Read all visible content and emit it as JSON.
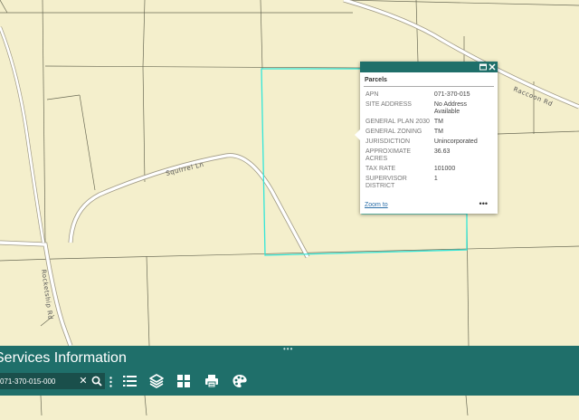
{
  "map": {
    "road_labels": [
      "Squirrel Ln",
      "Raccoon Rd",
      "Rocketship Rd"
    ]
  },
  "popup": {
    "title": "Parcels",
    "rows": [
      {
        "key": "APN",
        "value": "071-370-015"
      },
      {
        "key": "SITE ADDRESS",
        "value": "No Address Available"
      },
      {
        "key": "GENERAL PLAN 2030",
        "value": "TM"
      },
      {
        "key": "GENERAL ZONING",
        "value": "TM"
      },
      {
        "key": "JURISDICTION",
        "value": "Unincorporated"
      },
      {
        "key": "APPROXIMATE ACRES",
        "value": "36.63"
      },
      {
        "key": "TAX RATE",
        "value": "101000"
      },
      {
        "key": "SUPERVISOR DISTRICT",
        "value": "1"
      }
    ],
    "zoom_label": "Zoom to",
    "more_label": "•••",
    "maximize_icon": "maximize-icon",
    "close_icon": "close-icon"
  },
  "panel": {
    "title": "Services Information",
    "handle": "•••",
    "search_value": "071-370-015-000",
    "clear_label": "✕",
    "tools": [
      "list-icon",
      "layers-icon",
      "basemap-gallery-icon",
      "print-icon",
      "palette-icon"
    ]
  },
  "colors": {
    "map_background": "#f4efcc",
    "parcel_highlight": "#33e6d8",
    "panel": "#1f6f6a"
  }
}
